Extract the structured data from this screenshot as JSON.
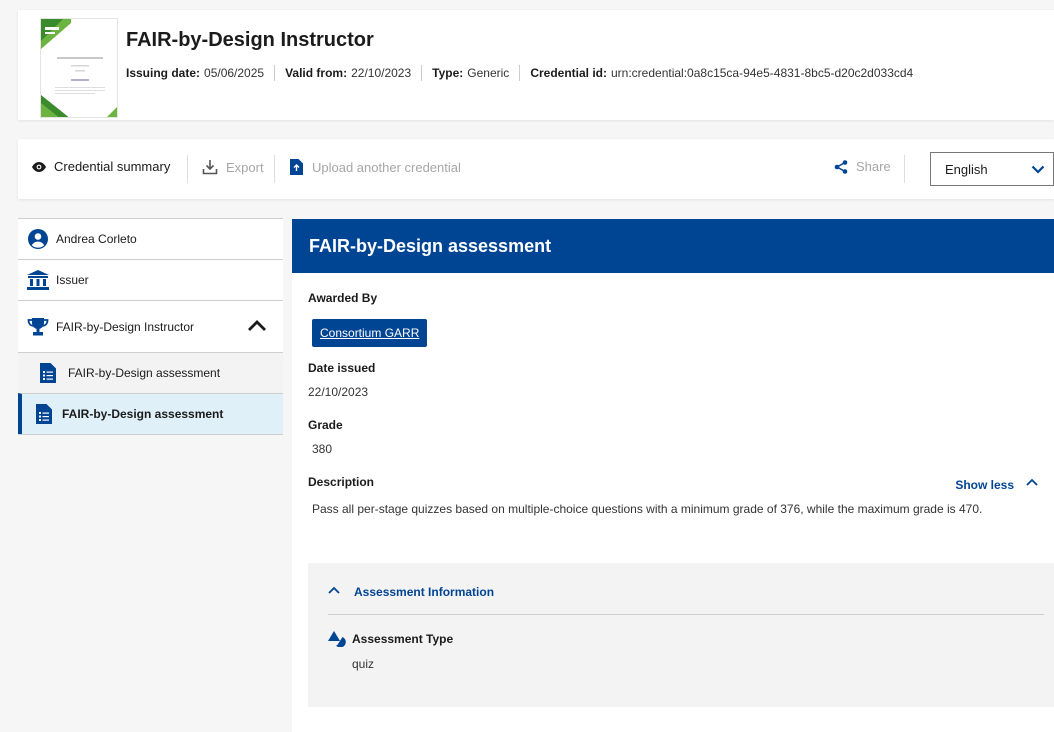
{
  "credential": {
    "title": "FAIR-by-Design Instructor",
    "issuing_date_label": "Issuing date:",
    "issuing_date": "05/06/2025",
    "valid_from_label": "Valid from:",
    "valid_from": "22/10/2023",
    "type_label": "Type:",
    "type": "Generic",
    "credential_id_label": "Credential id:",
    "credential_id": "urn:credential:0a8c15ca-94e5-4831-8bc5-d20c2d033cd4"
  },
  "toolbar": {
    "summary": "Credential summary",
    "export": "Export",
    "upload": "Upload another credential",
    "share": "Share",
    "language": "English"
  },
  "sidebar": {
    "items": [
      {
        "label": "Andrea Corleto",
        "icon": "user-circle-icon"
      },
      {
        "label": "Issuer",
        "icon": "institution-icon"
      },
      {
        "label": "FAIR-by-Design Instructor",
        "icon": "trophy-icon"
      },
      {
        "label": "FAIR-by-Design assessment",
        "icon": "document-list-icon"
      },
      {
        "label": "FAIR-by-Design assessment",
        "icon": "document-list-icon"
      }
    ]
  },
  "main": {
    "title": "FAIR-by-Design assessment",
    "awarded_by_label": "Awarded By",
    "awarded_by": "Consortium GARR",
    "date_issued_label": "Date issued",
    "date_issued": "22/10/2023",
    "grade_label": "Grade",
    "grade": "380",
    "description_label": "Description",
    "show_less": "Show less",
    "description": "Pass all per-stage quizzes based on multiple-choice questions with a minimum grade of 376, while the maximum grade is 470.",
    "assessment_info_label": "Assessment Information",
    "assessment_type_label": "Assessment Type",
    "assessment_type": "quiz"
  },
  "colors": {
    "primary": "#004494",
    "active_bg": "#dff0f8",
    "disabled": "#a6a6a6"
  }
}
